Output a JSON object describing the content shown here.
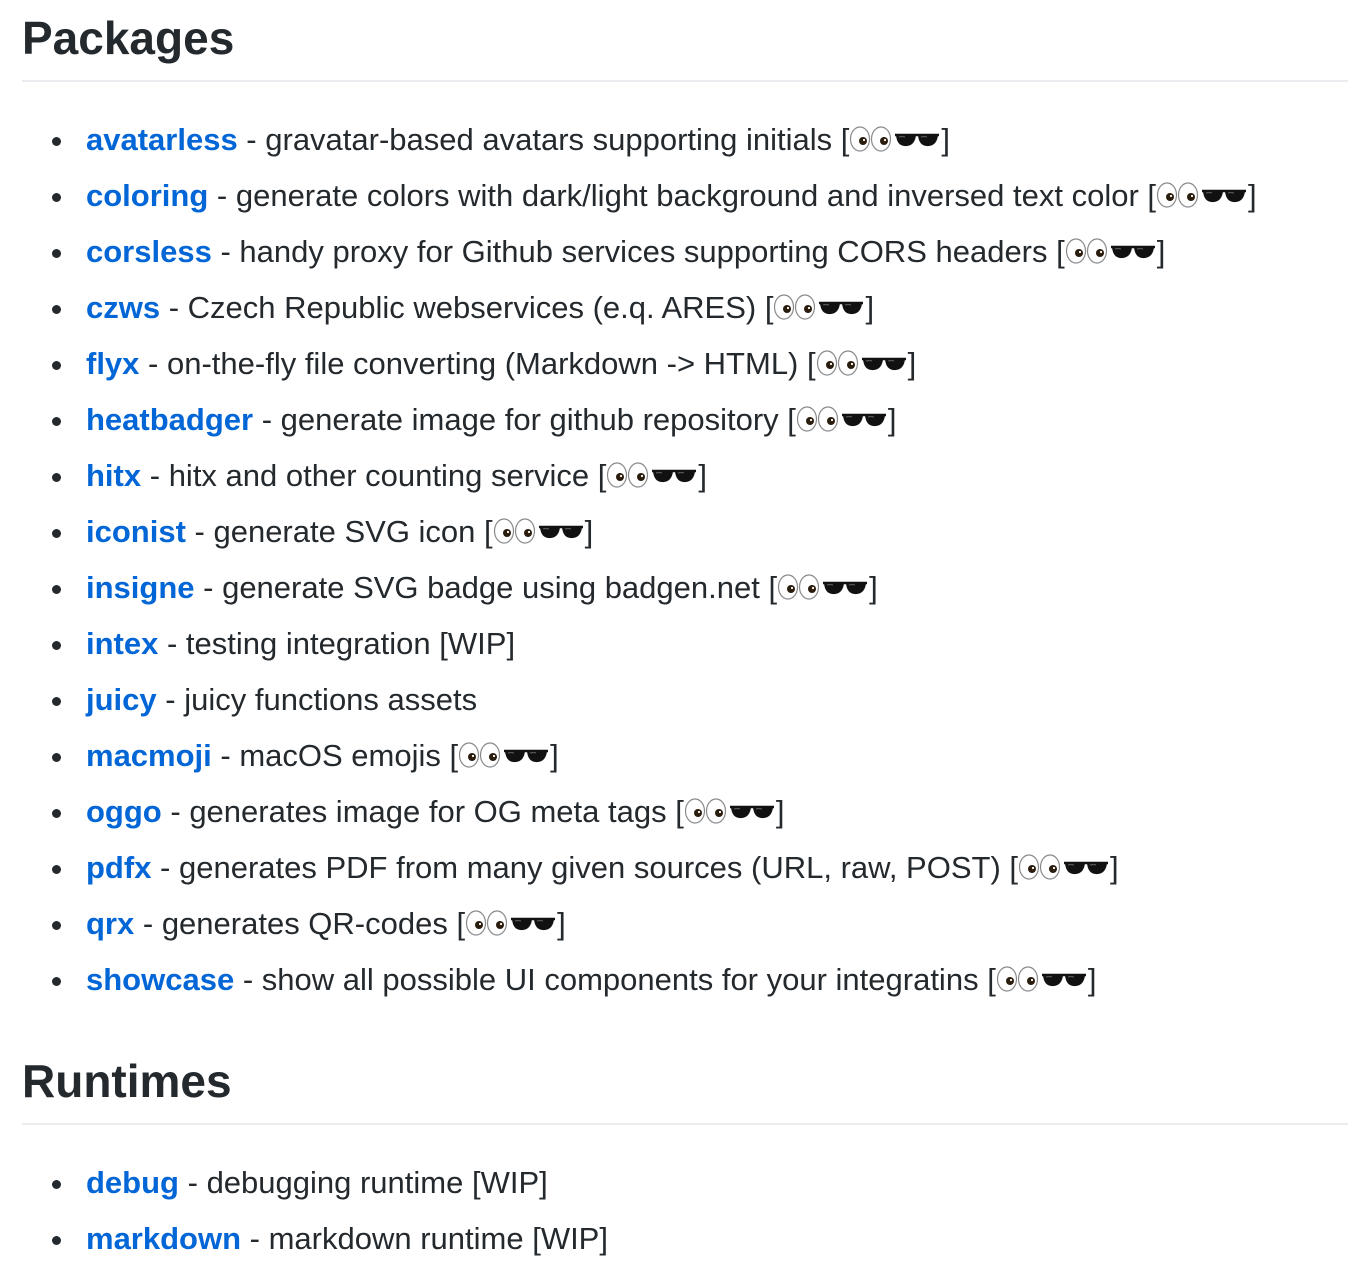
{
  "sections": [
    {
      "title": "Packages",
      "items": [
        {
          "name": "avatarless",
          "description": "gravatar-based avatars supporting initials",
          "status_icons": [
            "eyes-icon",
            "sunglasses-icon"
          ]
        },
        {
          "name": "coloring",
          "description": "generate colors with dark/light background and inversed text color",
          "status_icons": [
            "eyes-icon",
            "sunglasses-icon"
          ]
        },
        {
          "name": "corsless",
          "description": "handy proxy for Github services supporting CORS headers",
          "status_icons": [
            "eyes-icon",
            "sunglasses-icon"
          ]
        },
        {
          "name": "czws",
          "description": "Czech Republic webservices (e.q. ARES)",
          "status_icons": [
            "eyes-icon",
            "sunglasses-icon"
          ]
        },
        {
          "name": "flyx",
          "description": "on-the-fly file converting (Markdown -> HTML)",
          "status_icons": [
            "eyes-icon",
            "sunglasses-icon"
          ]
        },
        {
          "name": "heatbadger",
          "description": "generate image for github repository",
          "status_icons": [
            "eyes-icon",
            "sunglasses-icon"
          ]
        },
        {
          "name": "hitx",
          "description": "hitx and other counting service",
          "status_icons": [
            "eyes-icon",
            "sunglasses-icon"
          ]
        },
        {
          "name": "iconist",
          "description": "generate SVG icon",
          "status_icons": [
            "eyes-icon",
            "sunglasses-icon"
          ]
        },
        {
          "name": "insigne",
          "description": "generate SVG badge using badgen.net",
          "status_icons": [
            "eyes-icon",
            "sunglasses-icon"
          ]
        },
        {
          "name": "intex",
          "description": "testing integration",
          "status_text": "WIP"
        },
        {
          "name": "juicy",
          "description": "juicy functions assets"
        },
        {
          "name": "macmoji",
          "description": "macOS emojis",
          "status_icons": [
            "eyes-icon",
            "sunglasses-icon"
          ]
        },
        {
          "name": "oggo",
          "description": "generates image for OG meta tags",
          "status_icons": [
            "eyes-icon",
            "sunglasses-icon"
          ]
        },
        {
          "name": "pdfx",
          "description": "generates PDF from many given sources (URL, raw, POST)",
          "status_icons": [
            "eyes-icon",
            "sunglasses-icon"
          ]
        },
        {
          "name": "qrx",
          "description": "generates QR-codes",
          "status_icons": [
            "eyes-icon",
            "sunglasses-icon"
          ]
        },
        {
          "name": "showcase",
          "description": "show all possible UI components for your integratins",
          "status_icons": [
            "eyes-icon",
            "sunglasses-icon"
          ]
        }
      ]
    },
    {
      "title": "Runtimes",
      "items": [
        {
          "name": "debug",
          "description": "debugging runtime",
          "status_text": "WIP"
        },
        {
          "name": "markdown",
          "description": "markdown runtime",
          "status_text": "WIP"
        }
      ]
    }
  ],
  "colors": {
    "link": "#0366d6",
    "text": "#24292e",
    "divider": "#eaecef"
  }
}
